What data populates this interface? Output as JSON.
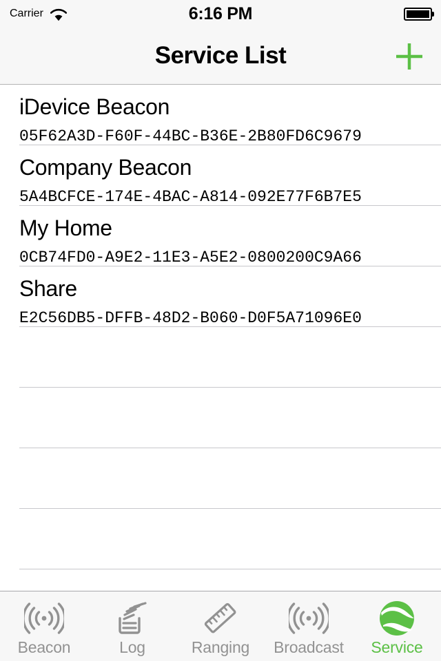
{
  "status_bar": {
    "carrier": "Carrier",
    "wifi_icon": "wifi-icon",
    "time": "6:16 PM",
    "battery_icon": "battery-full-icon"
  },
  "nav_bar": {
    "title": "Service List",
    "add_icon": "plus-icon",
    "accent_color": "#5cc046"
  },
  "list": {
    "rows": [
      {
        "title": "iDevice Beacon",
        "uuid": "05F62A3D-F60F-44BC-B36E-2B80FD6C9679"
      },
      {
        "title": "Company Beacon",
        "uuid": "5A4BCFCE-174E-4BAC-A814-092E77F6B7E5"
      },
      {
        "title": "My Home",
        "uuid": "0CB74FD0-A9E2-11E3-A5E2-0800200C9A66"
      },
      {
        "title": "Share",
        "uuid": "E2C56DB5-DFFB-48D2-B060-D0F5A71096E0"
      }
    ],
    "empty_row_count": 5
  },
  "tab_bar": {
    "active_color": "#5cc046",
    "inactive_color": "#929292",
    "tabs": [
      {
        "label": "Beacon",
        "icon": "beacon-waves-icon",
        "active": false
      },
      {
        "label": "Log",
        "icon": "log-tray-icon",
        "active": false
      },
      {
        "label": "Ranging",
        "icon": "ruler-icon",
        "active": false
      },
      {
        "label": "Broadcast",
        "icon": "broadcast-waves-icon",
        "active": false
      },
      {
        "label": "Service",
        "icon": "globe-sphere-icon",
        "active": true
      }
    ]
  }
}
